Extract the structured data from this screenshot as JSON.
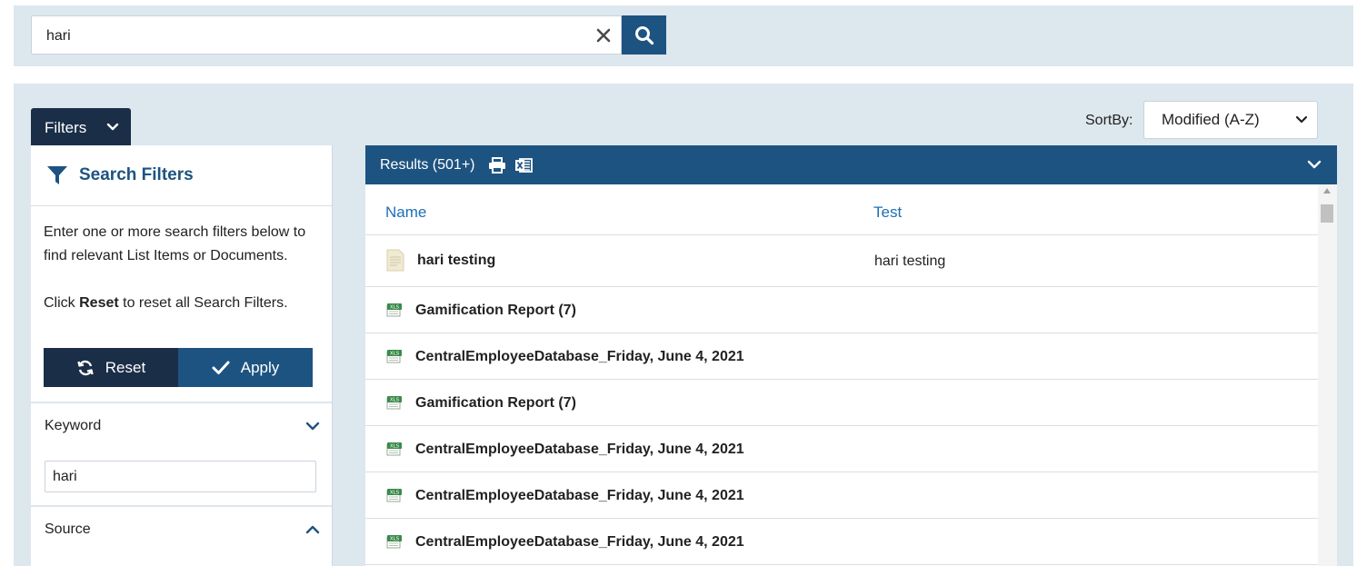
{
  "search": {
    "value": "hari",
    "clear_icon": "close-icon",
    "search_icon": "search-icon"
  },
  "filters": {
    "tab_label": "Filters",
    "panel_title": "Search Filters",
    "description": "Enter one or more search filters below to find relevant List Items or Documents.",
    "reset_hint_prefix": "Click ",
    "reset_hint_bold": "Reset",
    "reset_hint_suffix": " to reset all Search Filters.",
    "reset_label": "Reset",
    "apply_label": "Apply",
    "keyword": {
      "label": "Keyword",
      "value": "hari"
    },
    "source": {
      "label": "Source"
    }
  },
  "sort": {
    "label": "SortBy:",
    "selected": "Modified (A-Z)"
  },
  "results": {
    "title": "Results (501+)",
    "columns": [
      "Name",
      "Test"
    ],
    "rows": [
      {
        "name": "hari testing",
        "test": "hari testing",
        "icon": "document-icon"
      },
      {
        "name": "Gamification Report (7)",
        "test": "",
        "icon": "excel-file-icon"
      },
      {
        "name": "CentralEmployeeDatabase_Friday, June 4, 2021",
        "test": "",
        "icon": "excel-file-icon"
      },
      {
        "name": "Gamification Report (7)",
        "test": "",
        "icon": "excel-file-icon"
      },
      {
        "name": "CentralEmployeeDatabase_Friday, June 4, 2021",
        "test": "",
        "icon": "excel-file-icon"
      },
      {
        "name": "CentralEmployeeDatabase_Friday, June 4, 2021",
        "test": "",
        "icon": "excel-file-icon"
      },
      {
        "name": "CentralEmployeeDatabase_Friday, June 4, 2021",
        "test": "",
        "icon": "excel-file-icon"
      }
    ]
  },
  "colors": {
    "navy": "#1a2e48",
    "blue": "#1d5380",
    "band": "#dde7ee",
    "link": "#1d6fb5"
  }
}
